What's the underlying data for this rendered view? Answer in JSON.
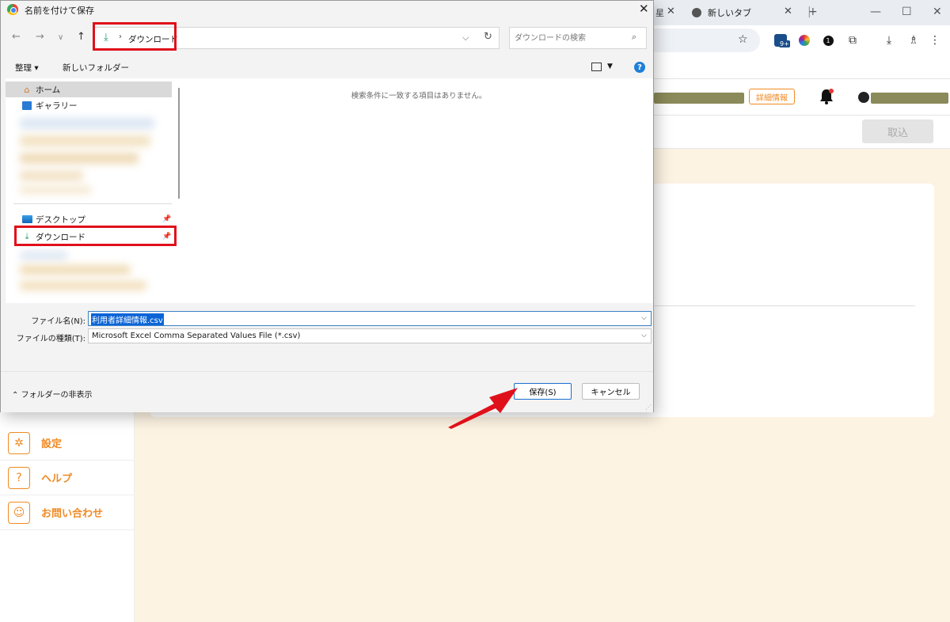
{
  "browser": {
    "tab_partial_text": "星",
    "tab_new_title": "新しいタブ",
    "tab_add": "+",
    "win_min": "—",
    "win_max": "☐",
    "win_close": "✕",
    "ext_badge": "9+",
    "ext_count": "1"
  },
  "app": {
    "detail_button": "詳細情報",
    "import_button": "取込",
    "sidebar": [
      {
        "label": "設定",
        "icon": "gear-icon"
      },
      {
        "label": "ヘルプ",
        "icon": "question-icon"
      },
      {
        "label": "お問い合わせ",
        "icon": "support-person-icon"
      }
    ],
    "accent_color": "#f08a24"
  },
  "dialog": {
    "title": "名前を付けて保存",
    "address_path": "ダウンロード",
    "search_placeholder": "ダウンロードの検索",
    "organize_label": "整理 ▾",
    "new_folder_label": "新しいフォルダー",
    "help_glyph": "?",
    "nav": {
      "home": "ホーム",
      "gallery": "ギャラリー",
      "desktop": "デスクトップ",
      "downloads": "ダウンロード"
    },
    "empty_message": "検索条件に一致する項目はありません。",
    "filename_label": "ファイル名(N):",
    "filename_value": "利用者詳細情報.csv",
    "filetype_label": "ファイルの種類(T):",
    "filetype_value": "Microsoft Excel Comma Separated Values File (*.csv)",
    "hide_folders": "フォルダーの非表示",
    "save_button": "保存(S)",
    "cancel_button": "キャンセル"
  },
  "annotation_color": "#e0101a"
}
